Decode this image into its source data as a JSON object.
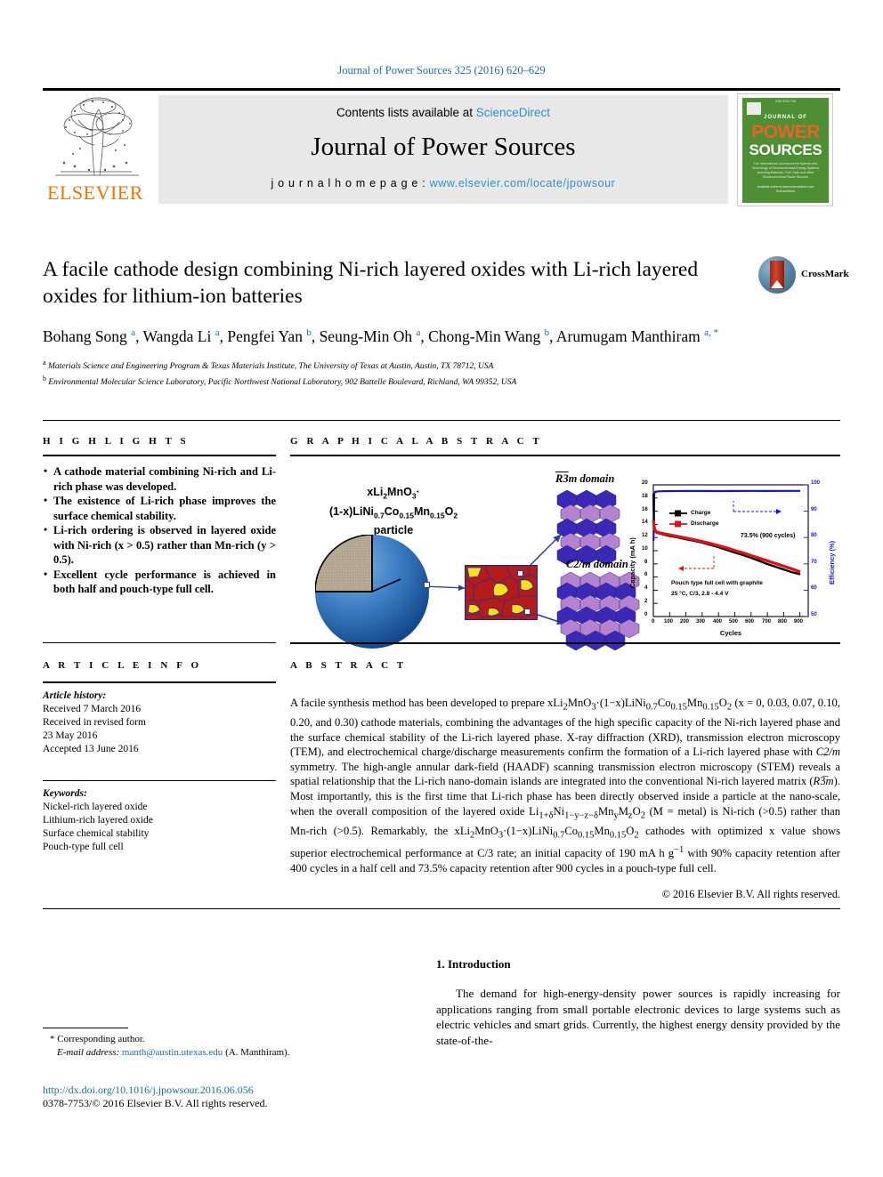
{
  "running_head": "Journal of Power Sources 325 (2016) 620–629",
  "masthead": {
    "contents_prefix": "Contents lists available at ",
    "contents_link": "ScienceDirect",
    "journal_title": "Journal of Power Sources",
    "homepage_prefix": "j o u r n a l   h o m e p a g e :  ",
    "homepage_url": "www.elsevier.com/locate/jpowsour",
    "publisher": "ELSEVIER",
    "cover": {
      "top_text": "ISSN 0378-7753",
      "line1": "JOURNAL OF",
      "line2": "POWER",
      "line3": "SOURCES",
      "subtitle": "The International Journal on the Science and Technology of Electrochemical Energy Systems including Batteries, Fuel Cells and other Electrochemical Power Sources",
      "footer": "Available online at www.sciencedirect.com ScienceDirect"
    }
  },
  "article": {
    "title": "A facile cathode design combining Ni-rich layered oxides with Li-rich layered oxides for lithium-ion batteries",
    "crossmark_label": "CrossMark",
    "authors_html": "Bohang Song <sup>a</sup>, Wangda Li <sup>a</sup>, Pengfei Yan <sup>b</sup>, Seung-Min Oh <sup>a</sup>, Chong-Min Wang <sup>b</sup>, Arumugam Manthiram <sup>a, *</sup>",
    "affiliation_a": "Materials Science and Engineering Program & Texas Materials Institute, The University of Texas at Austin, Austin, TX 78712, USA",
    "affiliation_b": "Environmental Molecular Science Laboratory, Pacific Northwest National Laboratory, 902 Battelle Boulevard, Richland, WA 99352, USA"
  },
  "highlights": {
    "heading": "H I G H L I G H T S",
    "items": [
      "A cathode material combining Ni-rich and Li-rich phase was developed.",
      "The existence of Li-rich phase improves the surface chemical stability.",
      "Li-rich ordering is observed in layered oxide with Ni-rich (x > 0.5) rather than Mn-rich (y > 0.5).",
      "Excellent cycle performance is achieved in both half and pouch-type full cell."
    ]
  },
  "graphical_abstract": {
    "heading": "G R A P H I C A L   A B S T R A C T",
    "figure": {
      "particle_formula_line1": "xLi2MnO3·",
      "particle_formula_line2": "(1-x)LiNi0.7Co0.15Mn0.15O2",
      "particle_formula_line3": "particle",
      "domain_label_top": "R3̅m domain",
      "domain_label_bottom": "C2/m domain"
    }
  },
  "chart_data": {
    "type": "line",
    "title": "",
    "xlabel": "Cycles",
    "ylabel": "Capacity (mA h)",
    "ylabel_right": "Efficiency (%)",
    "xlim": [
      0,
      950
    ],
    "ylim": [
      0,
      20
    ],
    "ylim_right": [
      50,
      100
    ],
    "xticks": [
      0,
      100,
      200,
      300,
      400,
      500,
      600,
      700,
      800,
      900
    ],
    "yticks": [
      0,
      2,
      4,
      6,
      8,
      10,
      12,
      14,
      16,
      18,
      20
    ],
    "yticks_right": [
      50,
      60,
      70,
      80,
      90,
      100
    ],
    "grid": false,
    "legend_position": "upper-left-inside",
    "annotation": "73.5% (900 cycles)",
    "note_line1": "Pouch type full cell with graphite",
    "note_line2": "25 °C, C/3, 2.8 - 4.4 V",
    "series": [
      {
        "name": "Charge",
        "color": "#000000",
        "x": [
          1,
          5,
          10,
          20,
          40,
          60,
          100,
          150,
          200,
          250,
          300,
          400,
          500,
          600,
          700,
          800,
          900
        ],
        "y": [
          18.6,
          14.3,
          13.3,
          13.0,
          12.8,
          12.7,
          12.5,
          12.3,
          12.1,
          11.9,
          11.7,
          11.3,
          10.9,
          10.6,
          10.3,
          10.1,
          9.8
        ]
      },
      {
        "name": "Discharge",
        "color": "#d81616",
        "x": [
          1,
          5,
          10,
          20,
          40,
          60,
          100,
          150,
          200,
          250,
          300,
          400,
          500,
          600,
          700,
          800,
          900
        ],
        "y": [
          14.6,
          13.6,
          13.2,
          13.0,
          12.9,
          12.8,
          12.6,
          12.4,
          12.2,
          12.0,
          11.8,
          11.4,
          11.0,
          10.7,
          10.4,
          10.2,
          9.9
        ]
      },
      {
        "name": "Efficiency",
        "color": "#1212d8",
        "axis": "right",
        "x": [
          1,
          10,
          50,
          100,
          200,
          300,
          400,
          500,
          600,
          700,
          800,
          900
        ],
        "y": [
          78,
          99.5,
          100.3,
          100.4,
          100.4,
          100.3,
          100.4,
          100.4,
          100.5,
          100.4,
          100.5,
          100.5
        ]
      }
    ]
  },
  "article_info": {
    "heading": "A R T I C L E   I N F O",
    "history_label": "Article history:",
    "history": [
      "Received 7 March 2016",
      "Received in revised form",
      "23 May 2016",
      "Accepted 13 June 2016"
    ],
    "keywords_label": "Keywords:",
    "keywords": [
      "Nickel-rich layered oxide",
      "Lithium-rich layered oxide",
      "Surface chemical stability",
      "Pouch-type full cell"
    ]
  },
  "abstract": {
    "heading": "A B S T R A C T",
    "text_html": "A facile synthesis method has been developed to prepare xLi<sub>2</sub>MnO<sub>3</sub>·(1&minus;x)LiNi<sub>0.7</sub>Co<sub>0.15</sub>Mn<sub>0.15</sub>O<sub>2</sub> (x = 0, 0.03, 0.07, 0.10, 0.20, and 0.30) cathode materials, combining the advantages of the high specific capacity of the Ni-rich layered phase and the surface chemical stability of the Li-rich layered phase. X-ray diffraction (XRD), transmission electron microscopy (TEM), and electrochemical charge/discharge measurements confirm the formation of a Li-rich layered phase with <i>C2/m</i> symmetry. The high-angle annular dark-field (HAADF) scanning transmission electron microscopy (STEM) reveals a spatial relationship that the Li-rich nano-domain islands are integrated into the conventional Ni-rich layered matrix (<i>R</i>3&#773;<i>m</i>). Most importantly, this is the first time that Li-rich phase has been directly observed inside a particle at the nano-scale, when the overall composition of the layered oxide Li<sub>1+δ</sub>Ni<sub>1&minus;y&minus;z&minus;δ</sub>Mn<sub>y</sub>M<sub>z</sub>O<sub>2</sub> (M = metal) is Ni-rich (&gt;0.5) rather than Mn-rich (&gt;0.5). Remarkably, the xLi<sub>2</sub>MnO<sub>3</sub>·(1&minus;x)LiNi<sub>0.7</sub>Co<sub>0.15</sub>Mn<sub>0.15</sub>O<sub>2</sub> cathodes with optimized x value shows superior electrochemical performance at C/3 rate; an initial capacity of 190 mA h g<sup>&minus;1</sup> with 90% capacity retention after 400 cycles in a half cell and 73.5% capacity retention after 900 cycles in a pouch-type full cell.",
    "copyright": "© 2016 Elsevier B.V. All rights reserved."
  },
  "introduction": {
    "heading": "1.  Introduction",
    "paragraph": "The demand for high-energy-density power sources is rapidly increasing for applications ranging from small portable electronic devices to large systems such as electric vehicles and smart grids. Currently, the highest energy density provided by the state-of-the-"
  },
  "footer": {
    "corresponding_marker": "*",
    "corresponding_label": "Corresponding author.",
    "email_label": "E-mail address:",
    "email": "manth@austin.utexas.edu",
    "email_suffix": "(A. Manthiram).",
    "doi_url": "http://dx.doi.org/10.1016/j.jpowsour.2016.06.056",
    "issn_line": "0378-7753/© 2016 Elsevier B.V. All rights reserved."
  },
  "colors": {
    "link": "#1b6ca8",
    "sciencedirect": "#2f8fd0",
    "elsevier_orange": "#ec7404",
    "cover_green": "#4e8f34",
    "chart_blue": "#1212d8",
    "chart_red": "#d81616"
  }
}
